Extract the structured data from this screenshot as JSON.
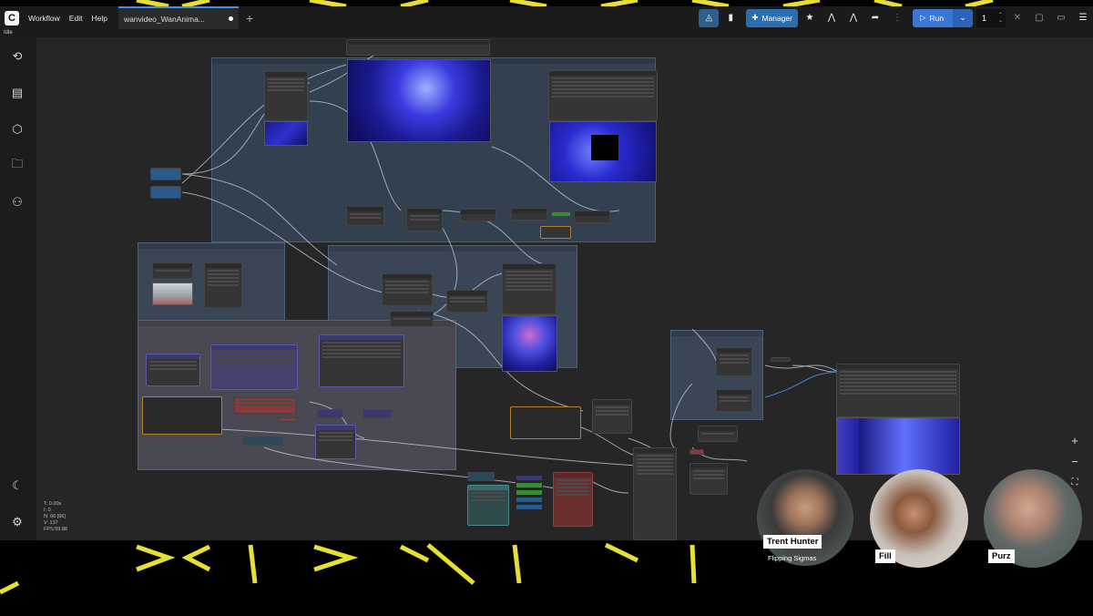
{
  "app": {
    "menu": [
      "Workflow",
      "Edit",
      "Help"
    ],
    "tab_title": "wanvideo_WanAnima...",
    "status": "Idle"
  },
  "toolbar": {
    "manager_label": "Manager",
    "run_label": "Run",
    "batch_count": "1"
  },
  "stats": {
    "t": "T: 0.00s",
    "i": "I: 0",
    "n": "N: 66 [66]",
    "v": "V: 137",
    "fps": "FPS:59.88"
  },
  "participants": [
    {
      "name": "Trent Hunter",
      "subtitle": "Flipping Sigmas"
    },
    {
      "name": "Fill"
    },
    {
      "name": "Purz"
    }
  ],
  "icons": {
    "sidebar": [
      "history-icon",
      "document-icon",
      "cube-icon",
      "folder-icon",
      "hierarchy-icon",
      "moon-icon",
      "gear-icon"
    ],
    "zoom": [
      "plus-icon",
      "minus-icon",
      "fit-icon"
    ]
  },
  "colors": {
    "accent_blue": "#3a78d6",
    "deco_yellow": "#e8e030",
    "canvas": "#262626"
  }
}
